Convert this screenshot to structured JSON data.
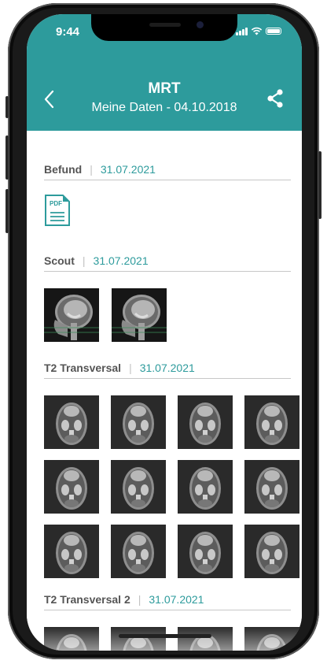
{
  "status": {
    "time": "9:44"
  },
  "header": {
    "title": "MRT",
    "subtitle": "Meine Daten - 04.10.2018",
    "color": "#2d9b9c"
  },
  "sections": [
    {
      "name": "Befund",
      "date": "31.07.2021",
      "items": [
        "pdf-file"
      ],
      "pdf_label": "PDF"
    },
    {
      "name": "Scout",
      "date": "31.07.2021",
      "items": [
        "sagittal",
        "sagittal"
      ]
    },
    {
      "name": "T2 Transversal",
      "date": "31.07.2021",
      "items": [
        "axial",
        "axial",
        "axial",
        "axial",
        "axial",
        "axial",
        "axial",
        "axial",
        "axial",
        "axial",
        "axial",
        "axial"
      ]
    },
    {
      "name": "T2 Transversal 2",
      "date": "31.07.2021",
      "items": [
        "axial",
        "axial",
        "axial",
        "axial"
      ]
    }
  ],
  "icons": {
    "back": "chevron-left-icon",
    "share": "share-icon",
    "pdf": "pdf-file-icon"
  },
  "colors": {
    "accent": "#2d9b9c",
    "text": "#555555",
    "divider": "#c7c7c7"
  }
}
